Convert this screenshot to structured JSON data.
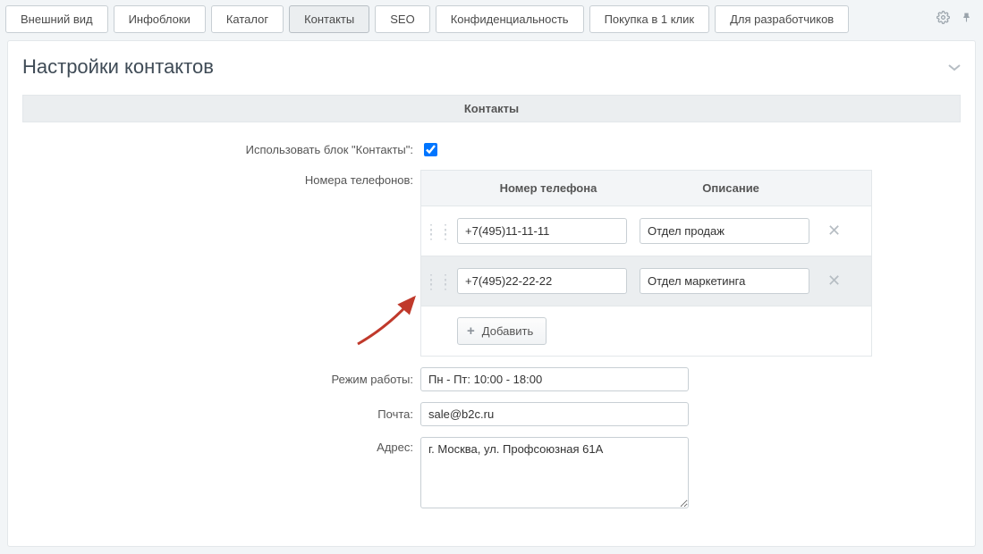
{
  "tabs": {
    "items": [
      {
        "label": "Внешний вид"
      },
      {
        "label": "Инфоблоки"
      },
      {
        "label": "Каталог"
      },
      {
        "label": "Контакты"
      },
      {
        "label": "SEO"
      },
      {
        "label": "Конфиденциальность"
      },
      {
        "label": "Покупка в 1 клик"
      },
      {
        "label": "Для разработчиков"
      }
    ],
    "active_index": 3
  },
  "panel": {
    "title": "Настройки контактов"
  },
  "section": {
    "title": "Контакты"
  },
  "labels": {
    "use_block": "Использовать блок \"Контакты\":",
    "phones": "Номера телефонов:",
    "worktime": "Режим работы:",
    "email": "Почта:",
    "address": "Адрес:"
  },
  "phones_table": {
    "header_phone": "Номер телефона",
    "header_desc": "Описание",
    "rows": [
      {
        "phone": "+7(495)11-11-11",
        "desc": "Отдел продаж"
      },
      {
        "phone": "+7(495)22-22-22",
        "desc": "Отдел маркетинга"
      }
    ],
    "add_label": "Добавить"
  },
  "values": {
    "use_block_checked": true,
    "worktime": "Пн - Пт: 10:00 - 18:00",
    "email": "sale@b2c.ru",
    "address": "г. Москва, ул. Профсоюзная 61А"
  }
}
